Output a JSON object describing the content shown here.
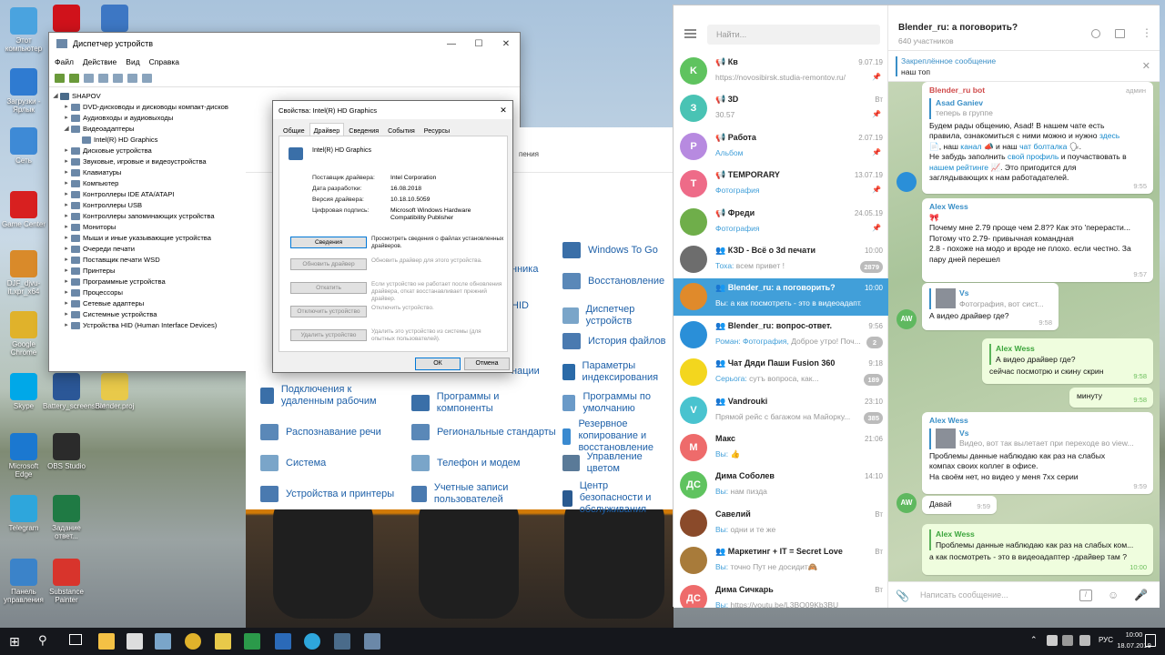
{
  "desktop": {
    "icons": [
      {
        "label": "Этот компьютер",
        "color": "#4aa3df"
      },
      {
        "label": "",
        "color": "#d0121b"
      },
      {
        "label": "",
        "color": "#3d77c4"
      },
      {
        "label": "Загрузки - Ярлык",
        "color": "#2f7bd1"
      },
      {
        "label": "Сеть",
        "color": "#3e8ad6"
      },
      {
        "label": "Game Center",
        "color": "#d82020"
      },
      {
        "label": "DJF_djvu-it.xpr_x64",
        "color": "#d98a2a"
      },
      {
        "label": "Google Chrome",
        "color": "#e0b22b"
      },
      {
        "label": "Skype",
        "color": "#00a8e8"
      },
      {
        "label": "Battery_screenshot",
        "color": "#2b5797"
      },
      {
        "label": "Blender.proj",
        "color": "#e8c94a"
      },
      {
        "label": "Microsoft Edge",
        "color": "#1b78d0"
      },
      {
        "label": "OBS Studio",
        "color": "#2b2b2b"
      },
      {
        "label": "Telegram",
        "color": "#2ea6dc"
      },
      {
        "label": "Задание ответ...",
        "color": "#1f7a44"
      },
      {
        "label": "Панель управления",
        "color": "#3b83c9"
      },
      {
        "label": "Substance Painter",
        "color": "#d8342c"
      }
    ]
  },
  "device_manager": {
    "title": "Диспетчер устройств",
    "menu": [
      "Файл",
      "Действие",
      "Вид",
      "Справка"
    ],
    "root": "SHAPOV",
    "tree": [
      {
        "label": "DVD-дисководы и дисководы компакт-дисков",
        "level": 1,
        "expanded": false
      },
      {
        "label": "Аудиовходы и аудиовыходы",
        "level": 1,
        "expanded": false
      },
      {
        "label": "Видеоадаптеры",
        "level": 1,
        "expanded": true
      },
      {
        "label": "Intel(R) HD Graphics",
        "level": 2,
        "expanded": false
      },
      {
        "label": "Дисковые устройства",
        "level": 1,
        "expanded": false
      },
      {
        "label": "Звуковые, игровые и видеоустройства",
        "level": 1,
        "expanded": false
      },
      {
        "label": "Клавиатуры",
        "level": 1,
        "expanded": false
      },
      {
        "label": "Компьютер",
        "level": 1,
        "expanded": false
      },
      {
        "label": "Контроллеры IDE ATA/ATAPI",
        "level": 1,
        "expanded": false
      },
      {
        "label": "Контроллеры USB",
        "level": 1,
        "expanded": false
      },
      {
        "label": "Контроллеры запоминающих устройства",
        "level": 1,
        "expanded": false
      },
      {
        "label": "Мониторы",
        "level": 1,
        "expanded": false
      },
      {
        "label": "Мыши и иные указывающие устройства",
        "level": 1,
        "expanded": false
      },
      {
        "label": "Очереди печати",
        "level": 1,
        "expanded": false
      },
      {
        "label": "Поставщик печати WSD",
        "level": 1,
        "expanded": false
      },
      {
        "label": "Принтеры",
        "level": 1,
        "expanded": false
      },
      {
        "label": "Программные устройства",
        "level": 1,
        "expanded": false
      },
      {
        "label": "Процессоры",
        "level": 1,
        "expanded": false
      },
      {
        "label": "Сетевые адаптеры",
        "level": 1,
        "expanded": false
      },
      {
        "label": "Системные устройства",
        "level": 1,
        "expanded": false
      },
      {
        "label": "Устройства HID (Human Interface Devices)",
        "level": 1,
        "expanded": false
      }
    ]
  },
  "properties": {
    "title": "Свойства: Intel(R) HD Graphics",
    "tabs": [
      "Общие",
      "Драйвер",
      "Сведения",
      "События",
      "Ресурсы"
    ],
    "active_tab": "Драйвер",
    "device": "Intel(R) HD Graphics",
    "fields": [
      {
        "key": "Поставщик драйвера:",
        "value": "Intel Corporation"
      },
      {
        "key": "Дата разработки:",
        "value": "16.08.2018"
      },
      {
        "key": "Версия драйвера:",
        "value": "10.18.10.5059"
      },
      {
        "key": "Цифровая подпись:",
        "value": "Microsoft Windows Hardware Compatibility Publisher"
      }
    ],
    "buttons": [
      {
        "label": "Сведения",
        "desc": "Просмотреть сведения о файлах установленных драйверов.",
        "enabled": true
      },
      {
        "label": "Обновить драйвер",
        "desc": "Обновить драйвер для этого устройства.",
        "enabled": false
      },
      {
        "label": "Откатить",
        "desc": "Если устройство не работает после обновления драйвера, откат восстанавливает прежний драйвер.",
        "enabled": false
      },
      {
        "label": "Отключить устройство",
        "desc": "Отключить устройство.",
        "enabled": false
      },
      {
        "label": "Удалить устройство",
        "desc": "Удалить это устройство из системы (для опытных пользователей).",
        "enabled": false
      }
    ],
    "ok": "ОК",
    "cancel": "Отмена"
  },
  "control_panel": {
    "col1": [
      "Подключения к удаленным рабочим",
      "Распознавание речи",
      "Система",
      "Устройства и принтеры"
    ],
    "col2": [
      "Программы и компоненты",
      "Региональные стандарты",
      "Телефон и модем",
      "Учетные записи пользователей"
    ],
    "col2_partial": [
      "нника",
      "HID",
      "нации"
    ],
    "col3": [
      "Windows To Go",
      "Восстановление",
      "Диспетчер устройств",
      "История файлов",
      "Параметры индексирования",
      "Программы по умолчанию",
      "Резервное копирование и восстановление",
      "Управление цветом",
      "Центр безопасности и обслуживания"
    ],
    "header_partial": "пения"
  },
  "telegram": {
    "search_placeholder": "Найти...",
    "chats": [
      {
        "avatar": "K",
        "color": "#5fc35f",
        "name": "📢 Кв",
        "time": "9.07.19",
        "msg": "https://novosibirsk.studia-remontov.ru/",
        "sender": "",
        "pin": true,
        "badge": ""
      },
      {
        "avatar": "З",
        "color": "#49c3b4",
        "name": "📢 3D",
        "time": "Вт",
        "msg": "30.57",
        "sender": "",
        "pin": true,
        "badge": ""
      },
      {
        "avatar": "Р",
        "color": "#b78ae0",
        "name": "📢 Работа",
        "time": "2.07.19",
        "msg": "",
        "sender": "Альбом",
        "pin": true,
        "badge": ""
      },
      {
        "avatar": "T",
        "color": "#ee6b88",
        "name": "📢 TEMPORARY",
        "time": "13.07.19",
        "msg": "",
        "sender": "Фотография",
        "pin": true,
        "badge": ""
      },
      {
        "avatar": "",
        "color": "#6fae4a",
        "name": "📢 Фреди",
        "time": "24.05.19",
        "msg": "",
        "sender": "Фотография",
        "pin": true,
        "badge": ""
      },
      {
        "avatar": "",
        "color": "#6d6d6d",
        "name": "👥 КЗD - Всё о 3d печати",
        "time": "10:00",
        "msg": "всем привет !",
        "sender": "Тоха:",
        "pin": false,
        "badge": "2879"
      },
      {
        "avatar": "",
        "color": "#e08a2b",
        "name": "👥 Blender_ru: а поговорить?",
        "time": "10:00",
        "msg": "а как посмотреть - это в видеоадапт...",
        "sender": "Вы:",
        "pin": false,
        "badge": "",
        "selected": true
      },
      {
        "avatar": "",
        "color": "#2a8fd8",
        "name": "👥 Blender_ru: вопрос-ответ.",
        "time": "9:56",
        "msg": "Доброе утро! Поч...",
        "sender": "Роман: Фотография,",
        "pin": false,
        "badge": "2"
      },
      {
        "avatar": "",
        "color": "#f3d61e",
        "name": "👥 Чат Дяди Паши Fusion 360",
        "time": "9:18",
        "msg": "сутъ вопроса, как...",
        "sender": "Серьога:",
        "pin": false,
        "badge": "189"
      },
      {
        "avatar": "V",
        "color": "#49c3cf",
        "name": "👥 Vandrouki",
        "time": "23:10",
        "msg": "Прямой рейс с багажом на Майорку...",
        "sender": "",
        "pin": false,
        "badge": "385"
      },
      {
        "avatar": "М",
        "color": "#ee6b6b",
        "name": "Макс",
        "time": "21:06",
        "msg": "👍",
        "sender": "Вы:",
        "pin": false,
        "badge": ""
      },
      {
        "avatar": "ДС",
        "color": "#5fc35f",
        "name": "Дима Соболев",
        "time": "14:10",
        "msg": "нам пизда",
        "sender": "Вы:",
        "pin": false,
        "badge": ""
      },
      {
        "avatar": "",
        "color": "#8a4a2a",
        "name": "Савелий",
        "time": "Вт",
        "msg": "одни и те же",
        "sender": "Вы:",
        "pin": false,
        "badge": ""
      },
      {
        "avatar": "",
        "color": "#a87b3a",
        "name": "👥 Маркетинг + IT = Secret Love",
        "time": "Вт",
        "msg": "точно Пут не досидит🙈",
        "sender": "Вы:",
        "pin": false,
        "badge": ""
      },
      {
        "avatar": "ДС",
        "color": "#ee6b6b",
        "name": "Дима Сичкарь",
        "time": "Вт",
        "msg": "https://youtu.be/L3BO09Kb3BU",
        "sender": "Вы:",
        "pin": false,
        "badge": ""
      }
    ],
    "chat_title": "Blender_ru: а поговорить?",
    "chat_sub": "640 участников",
    "pinned_label": "Закреплённое сообщение",
    "pinned_text": "наш топ",
    "input_placeholder": "Написать сообщение...",
    "messages": {
      "m1_name": "Blender_ru bot",
      "m1_role": "админ",
      "m1_qname": "Asad Ganiev",
      "m1_qtext": "теперь в группе",
      "m1_l1": "Будем рады общению, Asad! В нашем чате есть",
      "m1_l2a": "правила, ознакомиться с ними можно и нужно ",
      "m1_l2b": "здесь",
      "m1_l3a": "📄, наш ",
      "m1_l3b": "канал",
      "m1_l3c": " 📣 и наш ",
      "m1_l3d": "чат болталка",
      "m1_l3e": " 🗣.",
      "m1_l4a": " Не забудь заполнить ",
      "m1_l4b": "свой профиль",
      "m1_l4c": " и поучаствовать в",
      "m1_l5a": "нашем рейтинге",
      "m1_l5b": " 📈. Это пригодится для",
      "m1_l6": "заглядывающих к нам работадателей.",
      "m1_time": "9:55",
      "m2_name": "Alex Wess",
      "m2_l1": "🎀",
      "m2_l2": "Почему мне 2.79 проще чем 2.8?? Как это 'перерасти...",
      "m2_l3": "Потому что 2.79- привычная командная",
      "m2_l4": "2.8 - похоже на модо и вроде не плохо. если честно. За",
      "m2_l5": "пару дней перешел",
      "m2_time": "9:57",
      "aw": "AW",
      "m3_qname": "Vs",
      "m3_qtext": "Фотография, вот сист...",
      "m3_text": "А видео драйвер где?",
      "m3_time": "9:58",
      "m4_name": "Alex Wess",
      "m4_qtext": "А видео драйвер где?",
      "m4_text": "сейчас посмотрю и скину скрин",
      "m4_time": "9:58",
      "m5_text": "минуту",
      "m5_time": "9:58",
      "m6_name": "Alex Wess",
      "m6_qname": "Vs",
      "m6_qtext": "Видео, вот так вылетает при переходе во view...",
      "m6_l1": "Проблемы данные наблюдаю как раз на слабых",
      "m6_l2": "компах своих коллег в офисе.",
      "m6_l3": "На своём нет, но видео у меня 7хх серии",
      "m6_time": "9:59",
      "m7_text": "Давай",
      "m7_time": "9:59",
      "m8_name": "Alex Wess",
      "m8_qtext": "Проблемы данные наблюдаю как раз на слабых ком...",
      "m8_text": "а как посмотреть - это в видеоадаптер  -драйвер   там ?",
      "m8_time": "10:00"
    }
  },
  "taskbar": {
    "lang": "РУС",
    "time": "10:00",
    "date": "18.07.2019"
  }
}
